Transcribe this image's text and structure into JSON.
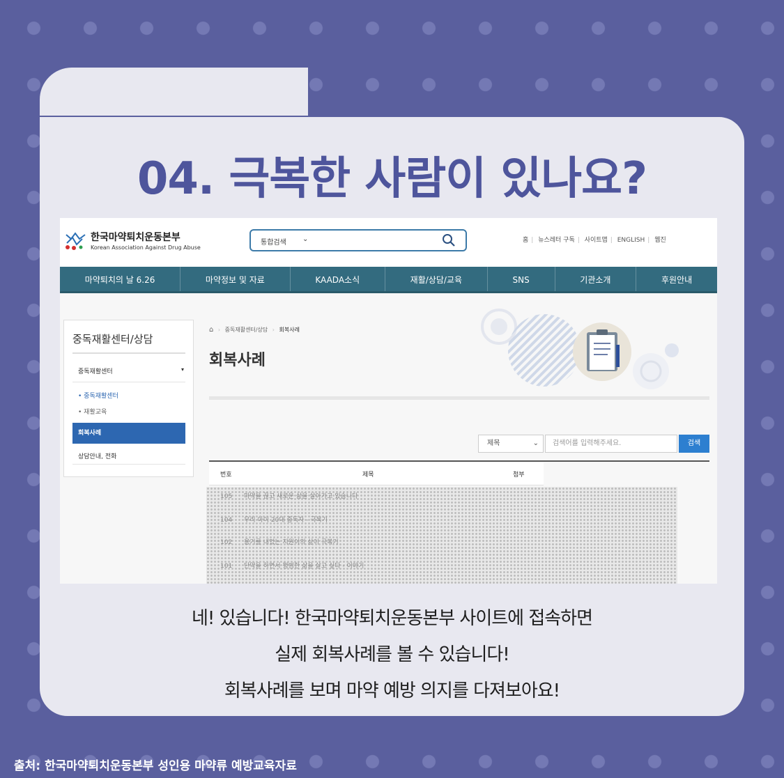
{
  "headline": "04. 극복한 사람이 있나요?",
  "site": {
    "logo_korean": "한국마약퇴치운동본부",
    "logo_english": "Korean Association Against Drug Abuse",
    "search_scope": "통합검색",
    "util_links": [
      "홈",
      "뉴스레터 구독",
      "사이트맵",
      "ENGLISH",
      "웹진"
    ],
    "nav": [
      "마약퇴치의 날 6.26",
      "마약정보 및 자료",
      "KAADA소식",
      "재활/상담/교육",
      "SNS",
      "기관소개",
      "후원안내"
    ],
    "sidebar": {
      "title": "중독재활센터/상담",
      "group": "중독재활센터",
      "subitems": [
        "중독재활센터",
        "재활교육"
      ],
      "active": "회복사례",
      "last": "상담안내, 전화"
    },
    "breadcrumb": [
      "중독재활센터/상담",
      "회복사례"
    ],
    "page_title": "회복사례",
    "filter": {
      "select": "제목",
      "placeholder": "검색어를 입력해주세요.",
      "button": "검색"
    },
    "table_headers": [
      "번호",
      "제목",
      "첨부"
    ],
    "rows": [
      {
        "num": "105",
        "title": "마약을 끊고 새로운 삶을 살아가고 있습니다"
      },
      {
        "num": "104",
        "title": "우리 아이 20대 중독자 - 극복기"
      },
      {
        "num": "102",
        "title": "용기를 내었는 지원이의 삶이 극복기"
      },
      {
        "num": "101",
        "title": "단약을 하면서 평범한 삶을 살고 싶다 - 이야기"
      }
    ]
  },
  "caption": [
    "네! 있습니다!  한국마약퇴치운동본부 사이트에 접속하면",
    "실제 회복사례를 볼 수 있습니다!",
    "회복사례를 보며 마약 예방 의지를 다져보아요!"
  ],
  "source": "출처: 한국마약퇴치운동본부 성인용 마약류 예방교육자료",
  "colors": {
    "background": "#5a5f9e",
    "card": "#e8e8f0",
    "headline": "#4e559c",
    "nav": "#336b7f",
    "sidebar_active": "#2d67b1",
    "search_button": "#2d7fd0"
  }
}
